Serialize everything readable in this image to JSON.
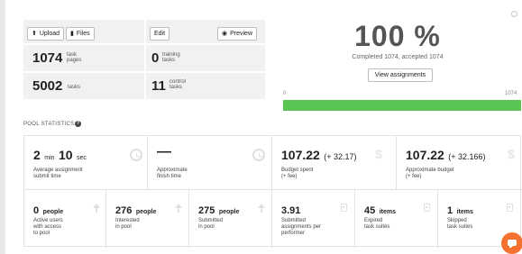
{
  "toolbar": {
    "upload_label": "Upload",
    "files_label": "Files",
    "edit_label": "Edit",
    "preview_label": "Preview"
  },
  "summary": {
    "task_pages": {
      "value": "1074",
      "label_line1": "task",
      "label_line2": "pages"
    },
    "training_tasks": {
      "value": "0",
      "label_line1": "training",
      "label_line2": "tasks"
    },
    "tasks": {
      "value": "5002",
      "label": "tasks"
    },
    "control_tasks": {
      "value": "11",
      "label_line1": "control",
      "label_line2": "tasks"
    }
  },
  "progress": {
    "percent_text": "100 %",
    "completed_text": "Completed 1074, accepted 1074",
    "view_button": "View assignments",
    "min_label": "0",
    "max_label": "1074",
    "fraction": 1.0,
    "fill_color": "#5ac553"
  },
  "pool_statistics": {
    "title": "POOL STATISTICS",
    "help_icon": "?"
  },
  "stats_row1": [
    {
      "value_html_parts": [
        "2",
        "min",
        "10",
        "sec"
      ],
      "label_line1": "Average assignment",
      "label_line2": "submit time",
      "icon": "clock-icon"
    },
    {
      "value": "—",
      "label_line1": "Approximate",
      "label_line2": "finish time",
      "icon": "clock-icon"
    },
    {
      "value": "107.22",
      "extra": "(+ 32.17)",
      "label_line1": "Budget spent",
      "label_line2": "(+ fee)",
      "icon": "dollar-icon"
    },
    {
      "value": "107.22",
      "extra": "(+ 32.166)",
      "label_line1": "Approximate budget",
      "label_line2": "(+ fee)",
      "icon": "dollar-icon"
    }
  ],
  "stats_row2": [
    {
      "value": "0",
      "unit": "people",
      "label_line1": "Active users",
      "label_line2": "with access",
      "label_line3": "to pool",
      "icon": "arrow-up-icon"
    },
    {
      "value": "276",
      "unit": "people",
      "label_line1": "Interested",
      "label_line2": "in pool",
      "icon": "arrow-up-icon"
    },
    {
      "value": "275",
      "unit": "people",
      "label_line1": "Submitted",
      "label_line2": "in pool",
      "icon": "arrow-up-icon"
    },
    {
      "value": "3.91",
      "label_line1": "Submitted",
      "label_line2": "assignments per",
      "label_line3": "performer",
      "icon": "document-icon"
    },
    {
      "value": "45",
      "unit": "items",
      "label_line1": "Expired",
      "label_line2": "task suites",
      "icon": "document-icon"
    },
    {
      "value": "1",
      "unit": "items",
      "label_line1": "Skipped",
      "label_line2": "task suites",
      "icon": "document-icon"
    }
  ]
}
